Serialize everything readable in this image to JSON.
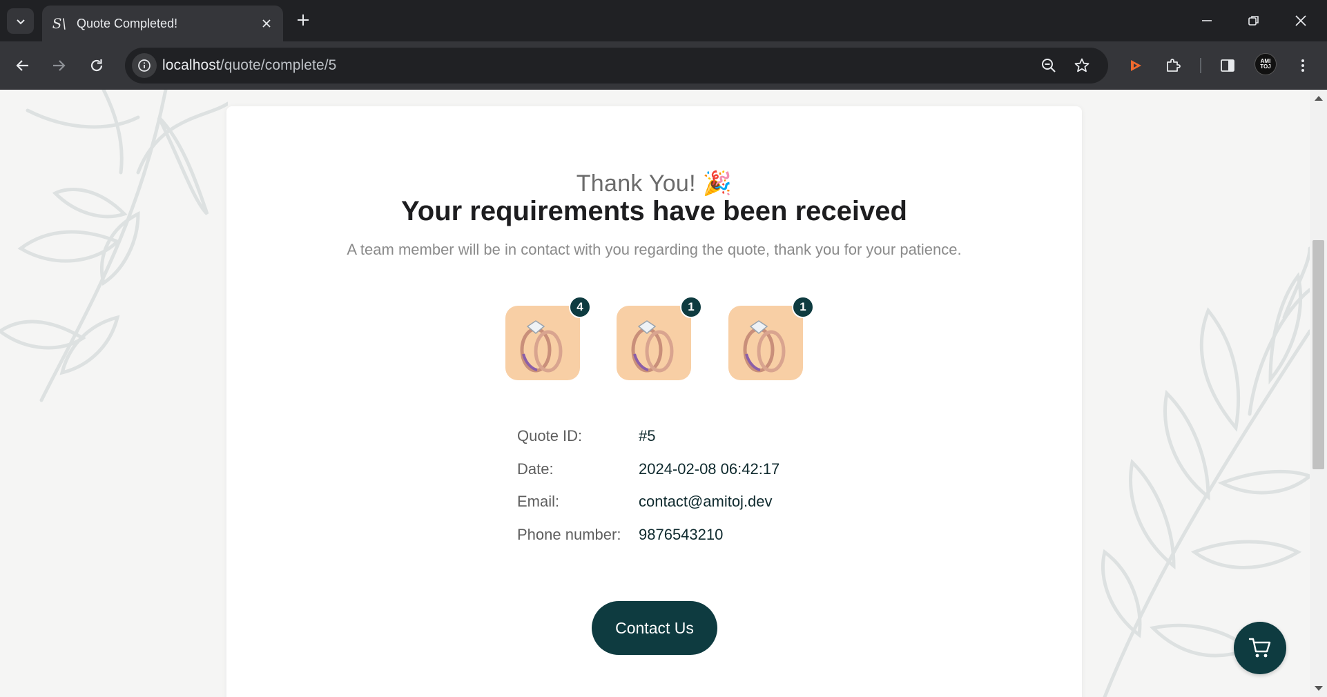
{
  "browser": {
    "tab_title": "Quote Completed!",
    "favicon_glyph": "S\\",
    "url_host": "localhost",
    "url_path": "/quote/complete/5",
    "profile_text": "AMI TOJ"
  },
  "page": {
    "thank_you": "Thank You!",
    "celebration_emoji": "🎉",
    "heading": "Your requirements have been received",
    "subtext": "A team member will be in contact with you regarding the quote, thank you for your patience.",
    "products": [
      {
        "quantity": "4"
      },
      {
        "quantity": "1"
      },
      {
        "quantity": "1"
      }
    ],
    "details": [
      {
        "label": "Quote ID:",
        "value": "#5"
      },
      {
        "label": "Date:",
        "value": "2024-02-08 06:42:17"
      },
      {
        "label": "Email:",
        "value": "contact@amitoj.dev"
      },
      {
        "label": "Phone number:",
        "value": "9876543210"
      }
    ],
    "contact_button": "Contact Us"
  },
  "colors": {
    "brand_primary": "#0e3b40",
    "product_bg": "#f8cfa5"
  }
}
